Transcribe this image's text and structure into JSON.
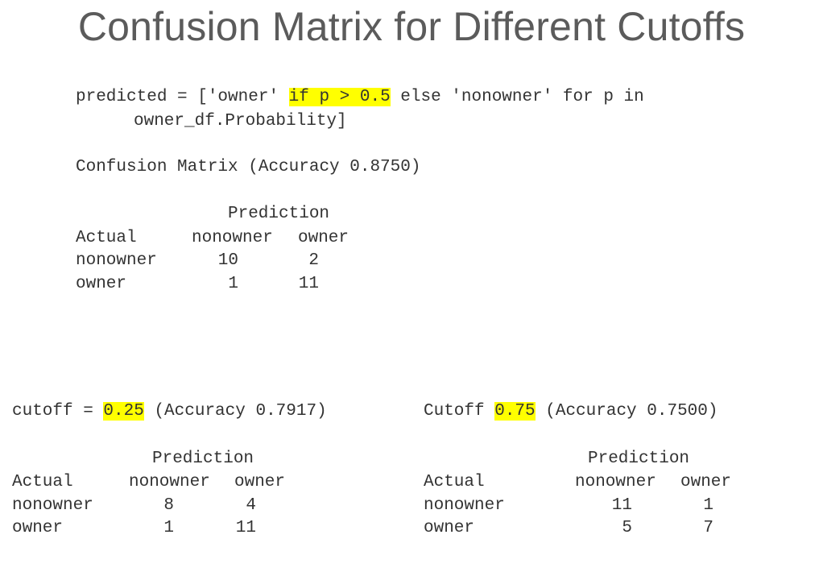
{
  "title": "Confusion Matrix for Different Cutoffs",
  "code": {
    "line1_prefix": "predicted = ['owner' ",
    "line1_highlight": "if p > 0.5",
    "line1_suffix": " else 'nonowner' for p in",
    "line2": "owner_df.Probability]"
  },
  "main_matrix": {
    "caption": "Confusion Matrix (Accuracy 0.8750)",
    "prediction_label": "Prediction",
    "actual_label": "Actual",
    "col_nonowner": "nonowner",
    "col_owner": "owner",
    "rows": [
      {
        "label": "nonowner",
        "nonowner": "10",
        "owner": "2"
      },
      {
        "label": "owner",
        "nonowner": "1",
        "owner": "11"
      }
    ]
  },
  "left_matrix": {
    "caption_prefix": "cutoff = ",
    "caption_highlight": "0.25",
    "caption_suffix": " (Accuracy 0.7917)",
    "prediction_label": "Prediction",
    "actual_label": "Actual",
    "col_nonowner": "nonowner",
    "col_owner": "owner",
    "rows": [
      {
        "label": "nonowner",
        "nonowner": "8",
        "owner": "4"
      },
      {
        "label": "owner",
        "nonowner": "1",
        "owner": "11"
      }
    ]
  },
  "right_matrix": {
    "caption_prefix": "Cutoff ",
    "caption_highlight": "0.75",
    "caption_suffix": " (Accuracy 0.7500)",
    "prediction_label": "Prediction",
    "actual_label": "Actual",
    "col_nonowner": "nonowner",
    "col_owner": "owner",
    "rows": [
      {
        "label": "nonowner",
        "nonowner": "11",
        "owner": "1"
      },
      {
        "label": "owner",
        "nonowner": "5",
        "owner": "7"
      }
    ]
  },
  "colors": {
    "highlight": "#ffff00",
    "title": "#5b5b5b",
    "text": "#333333"
  }
}
